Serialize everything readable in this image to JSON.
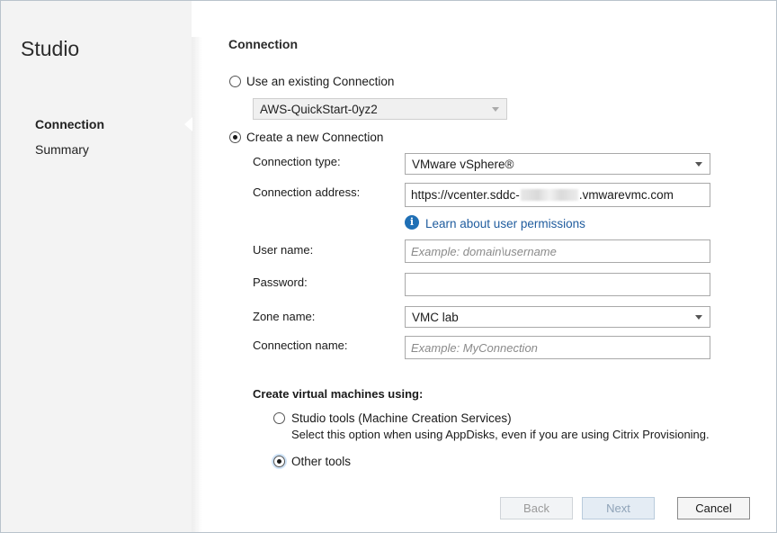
{
  "app": {
    "title": "Studio"
  },
  "nav": {
    "items": [
      {
        "label": "Connection",
        "active": true
      },
      {
        "label": "Summary",
        "active": false
      }
    ]
  },
  "main": {
    "section_title": "Connection",
    "existing": {
      "label": "Use an existing Connection",
      "selected_value": "AWS-QuickStart-0yz2",
      "checked": false
    },
    "new_connection": {
      "label": "Create a new Connection",
      "checked": true
    },
    "fields": {
      "connection_type": {
        "label": "Connection type:",
        "value": "VMware vSphere®"
      },
      "connection_address": {
        "label": "Connection address:",
        "value_prefix": "https://vcenter.sddc-",
        "value_suffix": ".vmwarevmc.com"
      },
      "permissions_link": "Learn about user permissions",
      "user_name": {
        "label": "User name:",
        "placeholder": "Example: domain\\username",
        "value": ""
      },
      "password": {
        "label": "Password:",
        "value": ""
      },
      "zone_name": {
        "label": "Zone name:",
        "value": "VMC lab"
      },
      "connection_name": {
        "label": "Connection name:",
        "placeholder": "Example: MyConnection",
        "value": ""
      }
    },
    "vm_tools": {
      "heading": "Create virtual machines using:",
      "studio_tools": {
        "label": "Studio tools (Machine Creation Services)",
        "checked": false,
        "description": "Select this option when using AppDisks, even if you are using Citrix Provisioning."
      },
      "other_tools": {
        "label": "Other tools",
        "checked": true
      }
    }
  },
  "footer": {
    "back_label": "Back",
    "next_label": "Next",
    "cancel_label": "Cancel"
  },
  "icons": {
    "info": "info-icon",
    "dropdown": "chevron-down-icon"
  }
}
